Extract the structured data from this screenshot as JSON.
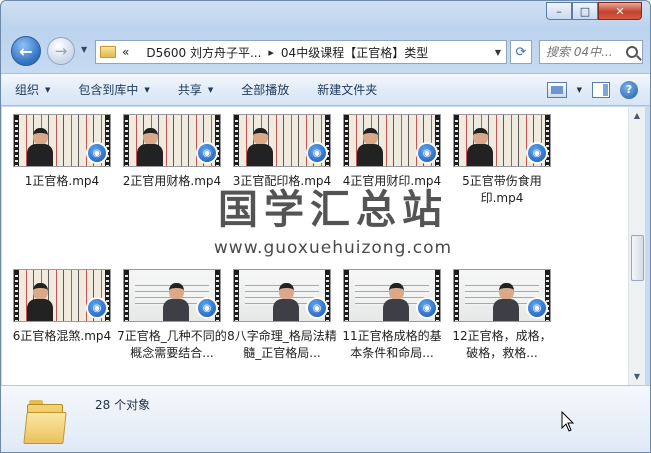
{
  "window": {
    "caption_buttons": {
      "minimize": "–",
      "maximize": "□",
      "close": "✕"
    }
  },
  "nav": {
    "back_glyph": "←",
    "forward_glyph": "→",
    "address": {
      "overflow": "«",
      "crumbs": [
        "D5600 刘方舟子平...",
        "04中级课程【正官格】类型"
      ],
      "separator": "▸"
    },
    "refresh_glyph": "⟳",
    "search": {
      "placeholder": "搜索 04中..."
    }
  },
  "toolbar": {
    "items": [
      {
        "label": "组织",
        "has_menu": true
      },
      {
        "label": "包含到库中",
        "has_menu": true
      },
      {
        "label": "共享",
        "has_menu": true
      },
      {
        "label": "全部播放",
        "has_menu": false
      },
      {
        "label": "新建文件夹",
        "has_menu": false
      }
    ],
    "help_glyph": "?"
  },
  "files": [
    {
      "name": "1正官格.mp4",
      "thumb": "notes"
    },
    {
      "name": "2正官用财格.mp4",
      "thumb": "notes"
    },
    {
      "name": "3正官配印格.mp4",
      "thumb": "notes"
    },
    {
      "name": "4正官用财印.mp4",
      "thumb": "notes"
    },
    {
      "name": "5正官带伤食用印.mp4",
      "thumb": "notes"
    },
    {
      "name": "6正官格混煞.mp4",
      "thumb": "notes"
    },
    {
      "name": "7正官格_几种不同的概念需要结合...",
      "thumb": "board"
    },
    {
      "name": "8八字命理_格局法精髓_正官格局...",
      "thumb": "board"
    },
    {
      "name": "11正官格成格的基本条件和命局...",
      "thumb": "board"
    },
    {
      "name": "12正官格，成格，破格，救格...",
      "thumb": "board"
    }
  ],
  "watermark": {
    "title": "国学汇总站",
    "url": "www.guoxuehuizong.com"
  },
  "status": {
    "count": "28 个对象"
  },
  "icons": {
    "file_overlay": "media-player-icon",
    "folder": "folder-icon"
  }
}
